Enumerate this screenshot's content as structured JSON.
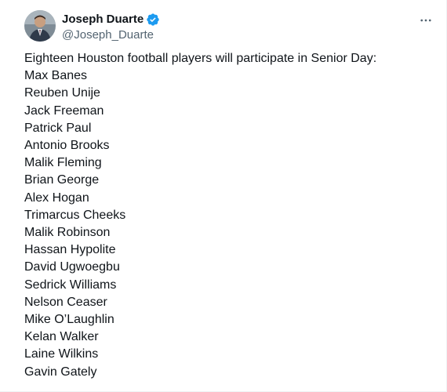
{
  "author": {
    "display_name": "Joseph Duarte",
    "handle": "@Joseph_Duarte",
    "verified": true,
    "verified_color": "#1d9bf0"
  },
  "tweet": {
    "intro": "Eighteen Houston football players will participate in Senior Day:",
    "players": [
      "Max Banes",
      "Reuben Unije",
      "Jack Freeman",
      "Patrick Paul",
      "Antonio Brooks",
      "Malik Fleming",
      "Brian George",
      "Alex Hogan",
      "Trimarcus Cheeks",
      "Malik Robinson",
      "Hassan Hypolite",
      "David Ugwoegbu",
      "Sedrick Williams",
      "Nelson Ceaser",
      "Mike O’Laughlin",
      "Kelan Walker",
      "Laine Wilkins",
      "Gavin Gately"
    ]
  },
  "icons": {
    "more": "more-horizontal-icon",
    "verified": "verified-badge-icon"
  }
}
